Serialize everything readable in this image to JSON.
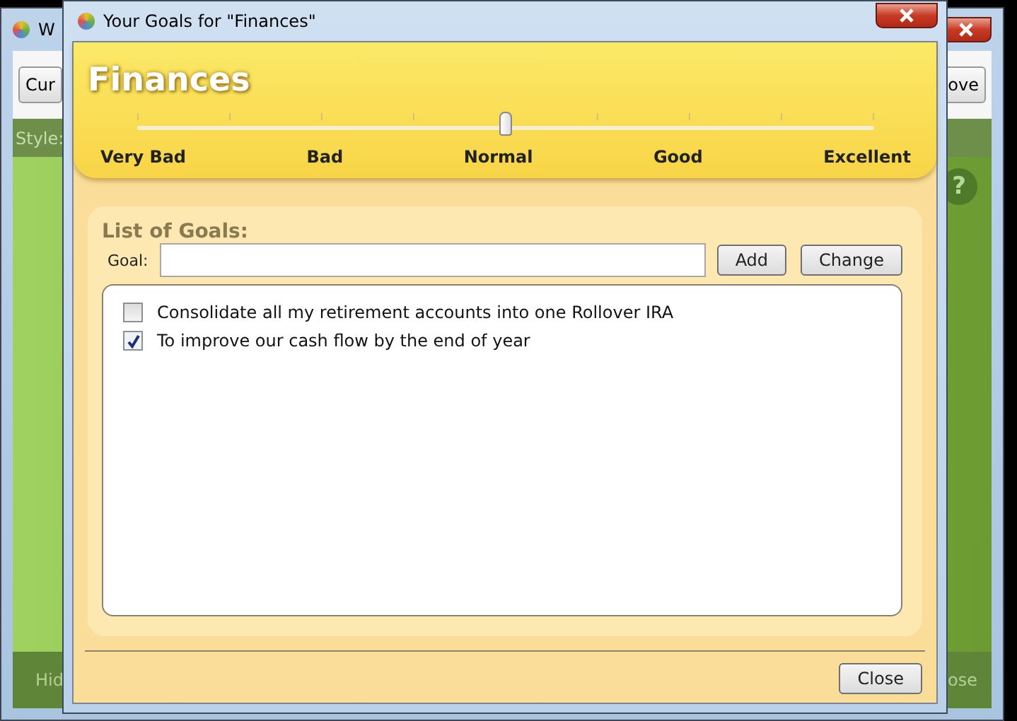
{
  "background_window": {
    "title": "W",
    "toolbar_button_left": "Cur",
    "toolbar_button_right": "ove",
    "style_label": "Style:",
    "help": "?",
    "footer_left": "Hid",
    "footer_right": "ose"
  },
  "dialog": {
    "title": "Your Goals for \"Finances\"",
    "heading": "Finances",
    "rating": {
      "level": 0.5,
      "labels": [
        "Very Bad",
        "Bad",
        "Normal",
        "Good",
        "Excellent"
      ]
    },
    "goals_title": "List of Goals:",
    "goal_label": "Goal:",
    "buttons": [
      "Add",
      "Change"
    ],
    "goals": [
      {
        "text": "Consolidate all my retirement accounts into one Rollover IRA",
        "checked": false
      },
      {
        "text": "To improve our cash flow by the end of year",
        "checked": true
      }
    ],
    "close_button": "Close"
  }
}
